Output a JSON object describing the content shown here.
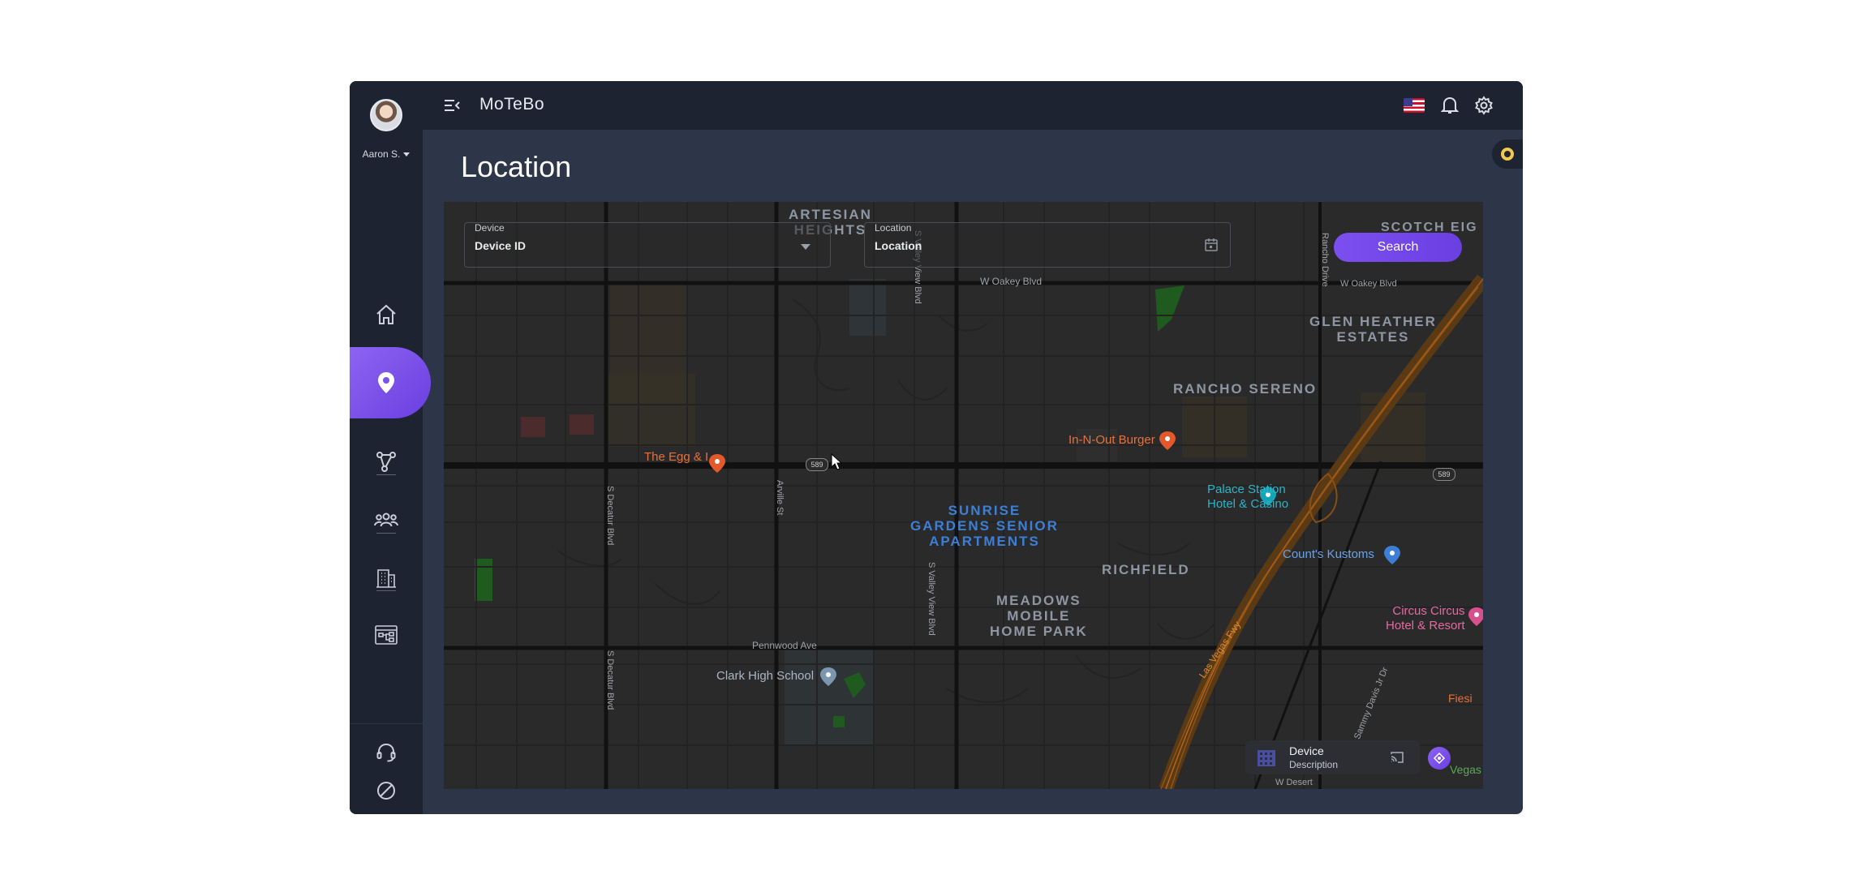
{
  "app": {
    "brand": "MoTeBo",
    "page_title": "Location"
  },
  "user": {
    "name": "Aaron S."
  },
  "sidebar": {
    "items": [
      {
        "name": "home",
        "icon": "home-icon"
      },
      {
        "name": "location",
        "icon": "location-pin-icon",
        "active": true
      },
      {
        "name": "routes",
        "icon": "share-nodes-icon"
      },
      {
        "name": "users",
        "icon": "users-group-icon"
      },
      {
        "name": "buildings",
        "icon": "building-icon"
      },
      {
        "name": "workflow",
        "icon": "workflow-icon"
      }
    ],
    "bottom": [
      {
        "name": "support",
        "icon": "headset-icon"
      },
      {
        "name": "block",
        "icon": "block-icon"
      }
    ]
  },
  "filters": {
    "device": {
      "label": "Device",
      "value": "Device ID"
    },
    "location": {
      "label": "Location",
      "value": "Location"
    },
    "search_label": "Search"
  },
  "map": {
    "areas": [
      {
        "text": "ARTESIAN\nHEIGHTS"
      },
      {
        "text": "SCOTCH EIG"
      },
      {
        "text": "GLEN HEATHER\nESTATES"
      },
      {
        "text": "RANCHO SERENO"
      },
      {
        "text": "SUNRISE\nGARDENS SENIOR\nAPARTMENTS"
      },
      {
        "text": "RICHFIELD"
      },
      {
        "text": "MEADOWS\nMOBILE\nHOME PARK"
      }
    ],
    "streets": {
      "w_oakey_1": "W Oakey Blvd",
      "w_oakey_2": "W Oakey Blvd",
      "s_valley_1": "S Valley View Blvd",
      "s_valley_2": "S Valley View Blvd",
      "s_decatur_1": "S Decatur Blvd",
      "s_decatur_2": "S Decatur Blvd",
      "arville": "Arville St",
      "rancho": "Rancho Drive",
      "pennwood": "Pennwood Ave",
      "las_vegas_fwy": "Las Vegas Fwy",
      "sammy_davis": "Sammy Davis Jr Dr",
      "w_desert": "W Desert"
    },
    "shields": {
      "s1": "589",
      "s2": "589"
    },
    "pois": {
      "egg": "The Egg & I",
      "innout": "In-N-Out Burger",
      "palace": "Palace Station\nHotel & Casino",
      "counts": "Count's Kustoms",
      "circus": "Circus Circus\nHotel & Resort",
      "clark": "Clark High School",
      "fiesta": "Fiesi",
      "vegas": "Vegas"
    }
  },
  "device_card": {
    "name": "Device",
    "description": "Description"
  },
  "colors": {
    "accent": "#7c4ff0",
    "sidebar": "#1d2330",
    "content": "#2c3648",
    "map_bg": "#2a2a2a"
  }
}
